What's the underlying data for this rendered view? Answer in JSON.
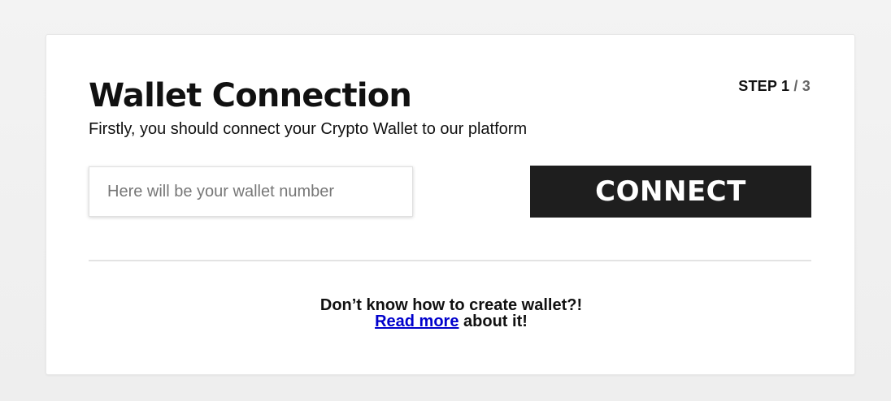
{
  "step": {
    "label": "STEP 1",
    "total": " / 3"
  },
  "header": {
    "title": "Wallet Connection",
    "subtitle": "Firstly, you should connect your Crypto Wallet to our platform"
  },
  "wallet_input": {
    "value": "",
    "placeholder": "Here will be your wallet number"
  },
  "connect_button": {
    "label": "CONNECT"
  },
  "help": {
    "question": "Don’t know how to create wallet?!",
    "link_text": "Read more",
    "suffix": " about it!"
  }
}
